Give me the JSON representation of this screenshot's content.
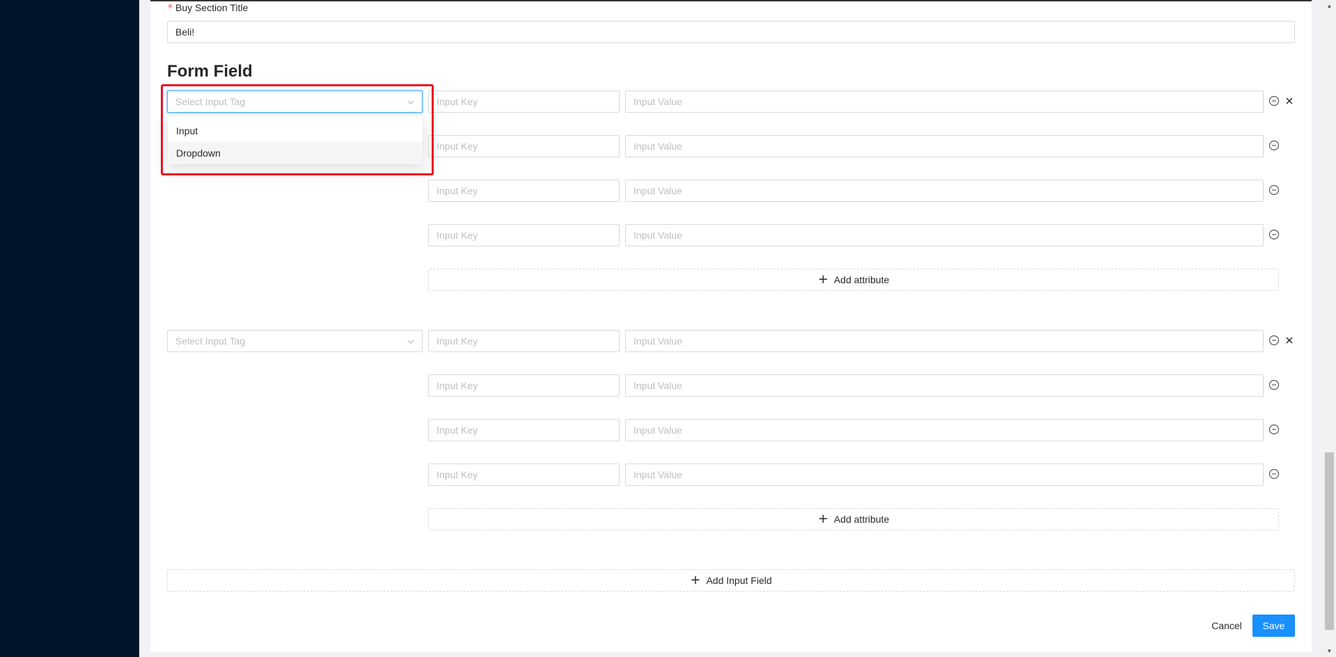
{
  "colors": {
    "sidebar": "#001529",
    "primary": "#1890ff",
    "required": "#ff4d4f",
    "highlight": "#e81123",
    "placeholder": "#bfbfbf",
    "border": "#d9d9d9"
  },
  "buy_section": {
    "required_mark": "*",
    "label": "Buy Section Title",
    "value": "Beli!"
  },
  "form_field": {
    "heading": "Form Field",
    "select_placeholder": "Select Input Tag",
    "key_placeholder": "Input Key",
    "value_placeholder": "Input Value",
    "add_attribute_label": "Add attribute",
    "dropdown_options": [
      "Input",
      "Dropdown"
    ],
    "add_input_field_label": "Add Input Field"
  },
  "icons": {
    "remove_attribute": "minus-circle-icon",
    "remove_field": "close-icon",
    "select_arrow": "chevron-down-icon",
    "add": "plus-icon"
  },
  "actions": {
    "cancel_label": "Cancel",
    "save_label": "Save"
  }
}
